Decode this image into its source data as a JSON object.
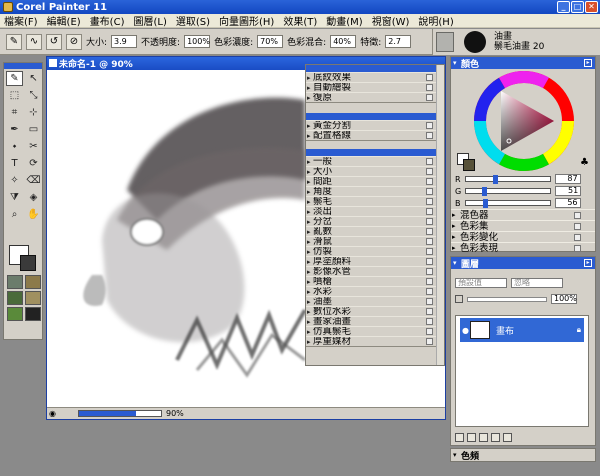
{
  "app": {
    "title": "Corel Painter 11"
  },
  "menu": [
    "檔案(F)",
    "編輯(E)",
    "畫布(C)",
    "圖層(L)",
    "選取(S)",
    "向量圖形(H)",
    "效果(T)",
    "動畫(M)",
    "視窗(W)",
    "說明(H)"
  ],
  "propbar": {
    "size_label": "大小:",
    "size_value": "3.9",
    "opacity_label": "不透明度:",
    "opacity_value": "100%",
    "resat_label": "色彩濃度:",
    "resat_value": "70%",
    "bleed_label": "色彩混合:",
    "bleed_value": "40%",
    "feature_label": "特徵:",
    "feature_value": "2.7"
  },
  "brush": {
    "category": "油畫",
    "variant": "鬃毛油畫 20"
  },
  "document": {
    "title": "未命名-1 @ 90%",
    "zoom": "90%"
  },
  "popup_groups": [
    [
      "底紋效果",
      "自動繪製",
      "復原"
    ],
    [
      "黃金分割",
      "配置格線"
    ],
    [
      "一般",
      "大小",
      "間距",
      "角度",
      "鬃毛",
      "淡出",
      "分岔",
      "亂數",
      "滑鼠",
      "仿製",
      "厚塗顏料",
      "影像水管",
      "噴槍",
      "水彩",
      "油墨",
      "數位水彩",
      "畫家油畫",
      "仿真鬃毛",
      "厚重媒材"
    ]
  ],
  "color_panel": {
    "title": "顏色",
    "r_label": "R",
    "r_value": "87",
    "g_label": "G",
    "g_value": "51",
    "b_label": "B",
    "b_value": "56",
    "subsections": [
      "混色器",
      "色彩集",
      "色彩變化",
      "色彩表現"
    ]
  },
  "layers_panel": {
    "title": "圖層",
    "composite_method": "預設值",
    "composite_depth": "忽略",
    "opacity": "100%",
    "layer_name": "畫布"
  },
  "channels_panel": {
    "title": "色頻"
  },
  "colors": {
    "accent": "#2a5bd1",
    "panel_bg": "#d4d0c8",
    "selected_layer": "#3168d5"
  }
}
